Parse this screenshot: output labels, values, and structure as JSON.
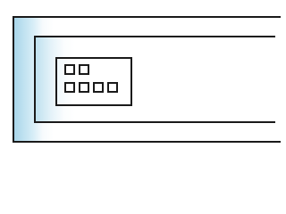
{
  "window": {
    "title": ""
  },
  "panels": {
    "outer_label": "",
    "inner_label": ""
  },
  "grid_widget": {
    "label": "",
    "tiles_top_row": 2,
    "tiles_bottom_row": 4
  },
  "colors": {
    "border": "#1a1a1a",
    "accent_edge": "#a9d6ea",
    "background": "#ffffff"
  },
  "icons": {
    "tiles": "square-tile-icon"
  }
}
